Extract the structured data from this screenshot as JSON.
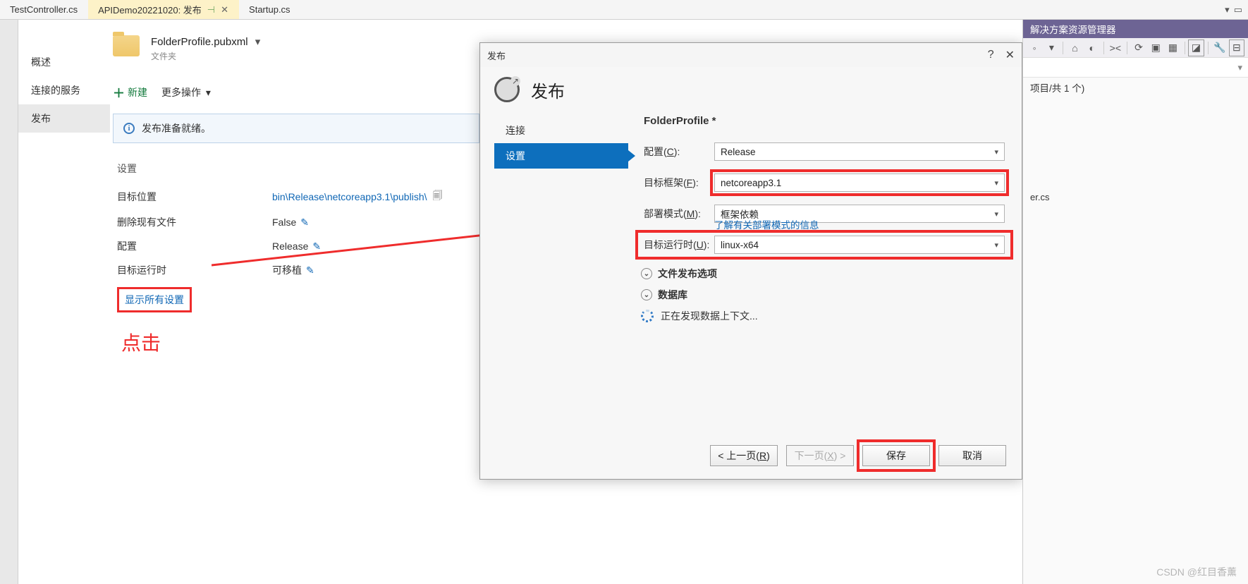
{
  "tabs": {
    "t1": "TestController.cs",
    "t2": "APIDemo20221020: 发布",
    "t3": "Startup.cs"
  },
  "leftNav": {
    "overview": "概述",
    "services": "连接的服务",
    "publish": "发布"
  },
  "profile": {
    "file": "FolderProfile.pubxml",
    "sub": "文件夹"
  },
  "toolbar": {
    "new": "新建",
    "more": "更多操作"
  },
  "banner": {
    "text": "发布准备就绪。"
  },
  "settings": {
    "heading": "设置",
    "targetLocLabel": "目标位置",
    "targetLocValue": "bin\\Release\\netcoreapp3.1\\publish\\",
    "deleteExistLabel": "删除现有文件",
    "deleteExistValue": "False",
    "configLabel": "配置",
    "configValue": "Release",
    "runtimeLabel": "目标运行时",
    "runtimeValue": "可移植",
    "showAll": "显示所有设置"
  },
  "annot": {
    "click": "点击"
  },
  "dialog": {
    "title": "发布",
    "heading": "发布",
    "side": {
      "conn": "连接",
      "settings": "设置"
    },
    "formTitle": "FolderProfile *",
    "configLabel": "配置(C):",
    "configValue": "Release",
    "fwLabel": "目标框架(F):",
    "fwValue": "netcoreapp3.1",
    "modeLabel": "部署模式(M):",
    "modeValue": "框架依赖",
    "modeLink": "了解有关部署模式的信息",
    "rtLabel": "目标运行时(U):",
    "rtValue": "linux-x64",
    "expandFile": "文件发布选项",
    "expandDb": "数据库",
    "loading": "正在发现数据上下文...",
    "prev": "< 上一页(R)",
    "next": "下一页(X) >",
    "save": "保存",
    "cancel": "取消"
  },
  "rightPane": {
    "title": "解决方案资源管理器",
    "count": "项目/共 1 个)",
    "cs": "er.cs"
  },
  "watermark": "CSDN @红目香薰"
}
